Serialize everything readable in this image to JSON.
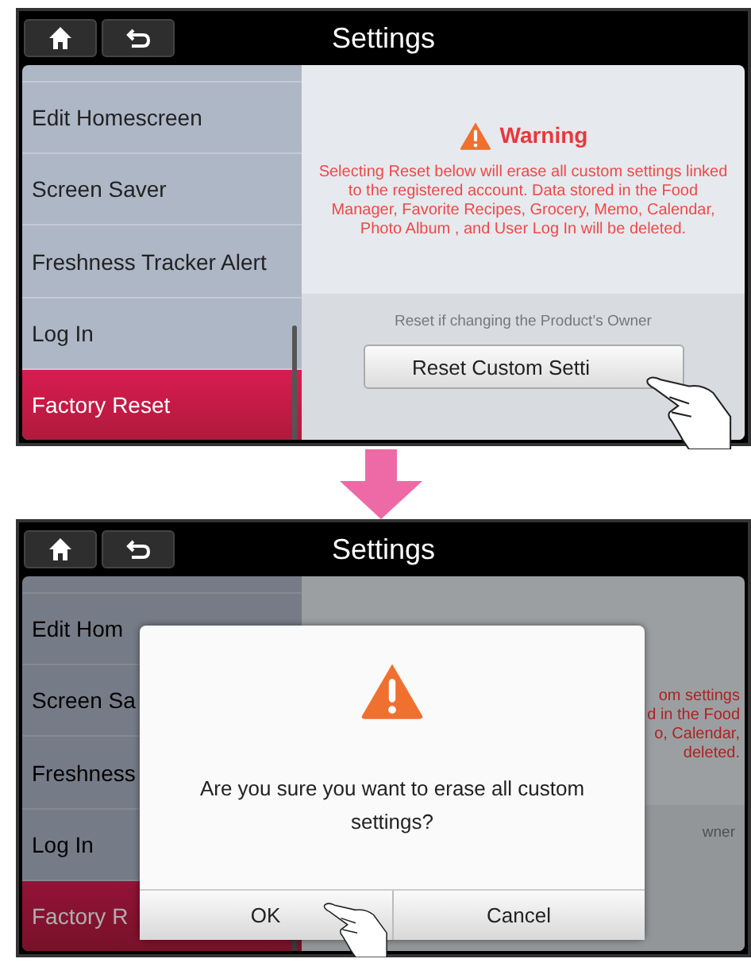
{
  "screens": [
    {
      "title": "Settings",
      "dimmed": false,
      "sidebar": {
        "items": [
          {
            "label": "Edit Homescreen",
            "selected": false
          },
          {
            "label": "Screen Saver",
            "selected": false
          },
          {
            "label": "Freshness Tracker Alert",
            "selected": false
          },
          {
            "label": "Log In",
            "selected": false
          },
          {
            "label": "Factory Reset",
            "selected": true
          }
        ]
      },
      "panel": {
        "warning_title": "Warning",
        "warning_lines": [
          "Selecting Reset below will erase all custom settings linked to the registered account. Data stored in the Food Manager, Favorite Recipes, Grocery, Memo, Calendar, Photo Album , and User Log In will be deleted."
        ],
        "hint": "Reset if changing the Product’s Owner",
        "button": "Reset Custom Setti"
      }
    },
    {
      "title": "Settings",
      "dimmed": true,
      "sidebar": {
        "items": [
          {
            "label": "Edit Hom",
            "selected": false
          },
          {
            "label": "Screen Sa",
            "selected": false
          },
          {
            "label": "Freshness",
            "selected": false
          },
          {
            "label": "Log In",
            "selected": false
          },
          {
            "label": "Factory R",
            "selected": true
          }
        ]
      },
      "panel": {
        "warning_lines": [
          "om settings",
          "d in the Food",
          "o, Calendar,",
          "deleted."
        ],
        "hint": "wner"
      },
      "dialog": {
        "message": "Are you sure you want to erase all custom settings?",
        "buttons": [
          "OK",
          "Cancel"
        ]
      }
    }
  ]
}
